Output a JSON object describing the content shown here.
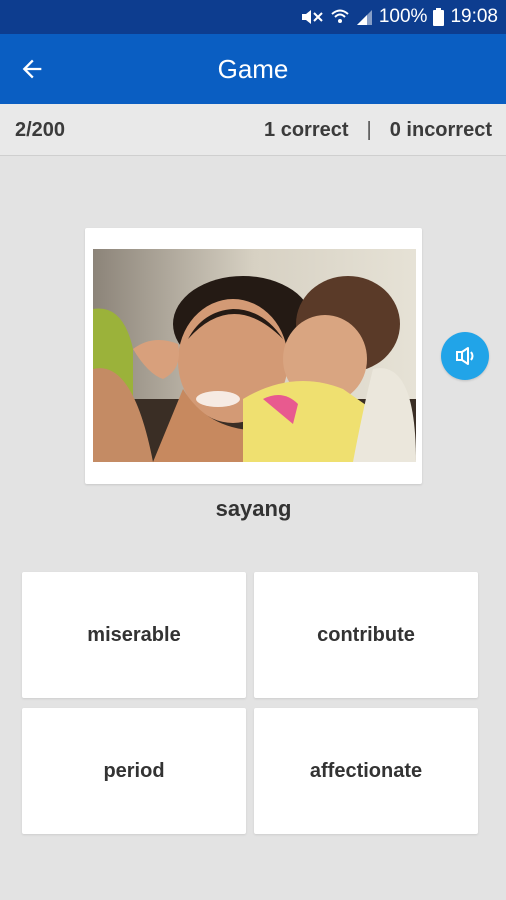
{
  "status_bar": {
    "battery": "100%",
    "time": "19:08",
    "icons": [
      "mute-icon",
      "wifi-icon",
      "signal-icon",
      "battery-icon"
    ]
  },
  "app_bar": {
    "title": "Game",
    "back_icon": "arrow-left-icon"
  },
  "score": {
    "progress": "2/200",
    "correct": "1 correct",
    "separator": "|",
    "incorrect": "0 incorrect"
  },
  "question": {
    "image": "mother-hugging-baby-photo",
    "sound_icon": "speaker-icon",
    "word": "sayang"
  },
  "answers": [
    {
      "label": "miserable"
    },
    {
      "label": "contribute"
    },
    {
      "label": "period"
    },
    {
      "label": "affectionate"
    }
  ],
  "colors": {
    "status_bar": "#0d3d8f",
    "app_bar": "#0a5ec2",
    "sound_button": "#21a4e8",
    "background": "#e3e3e3"
  }
}
